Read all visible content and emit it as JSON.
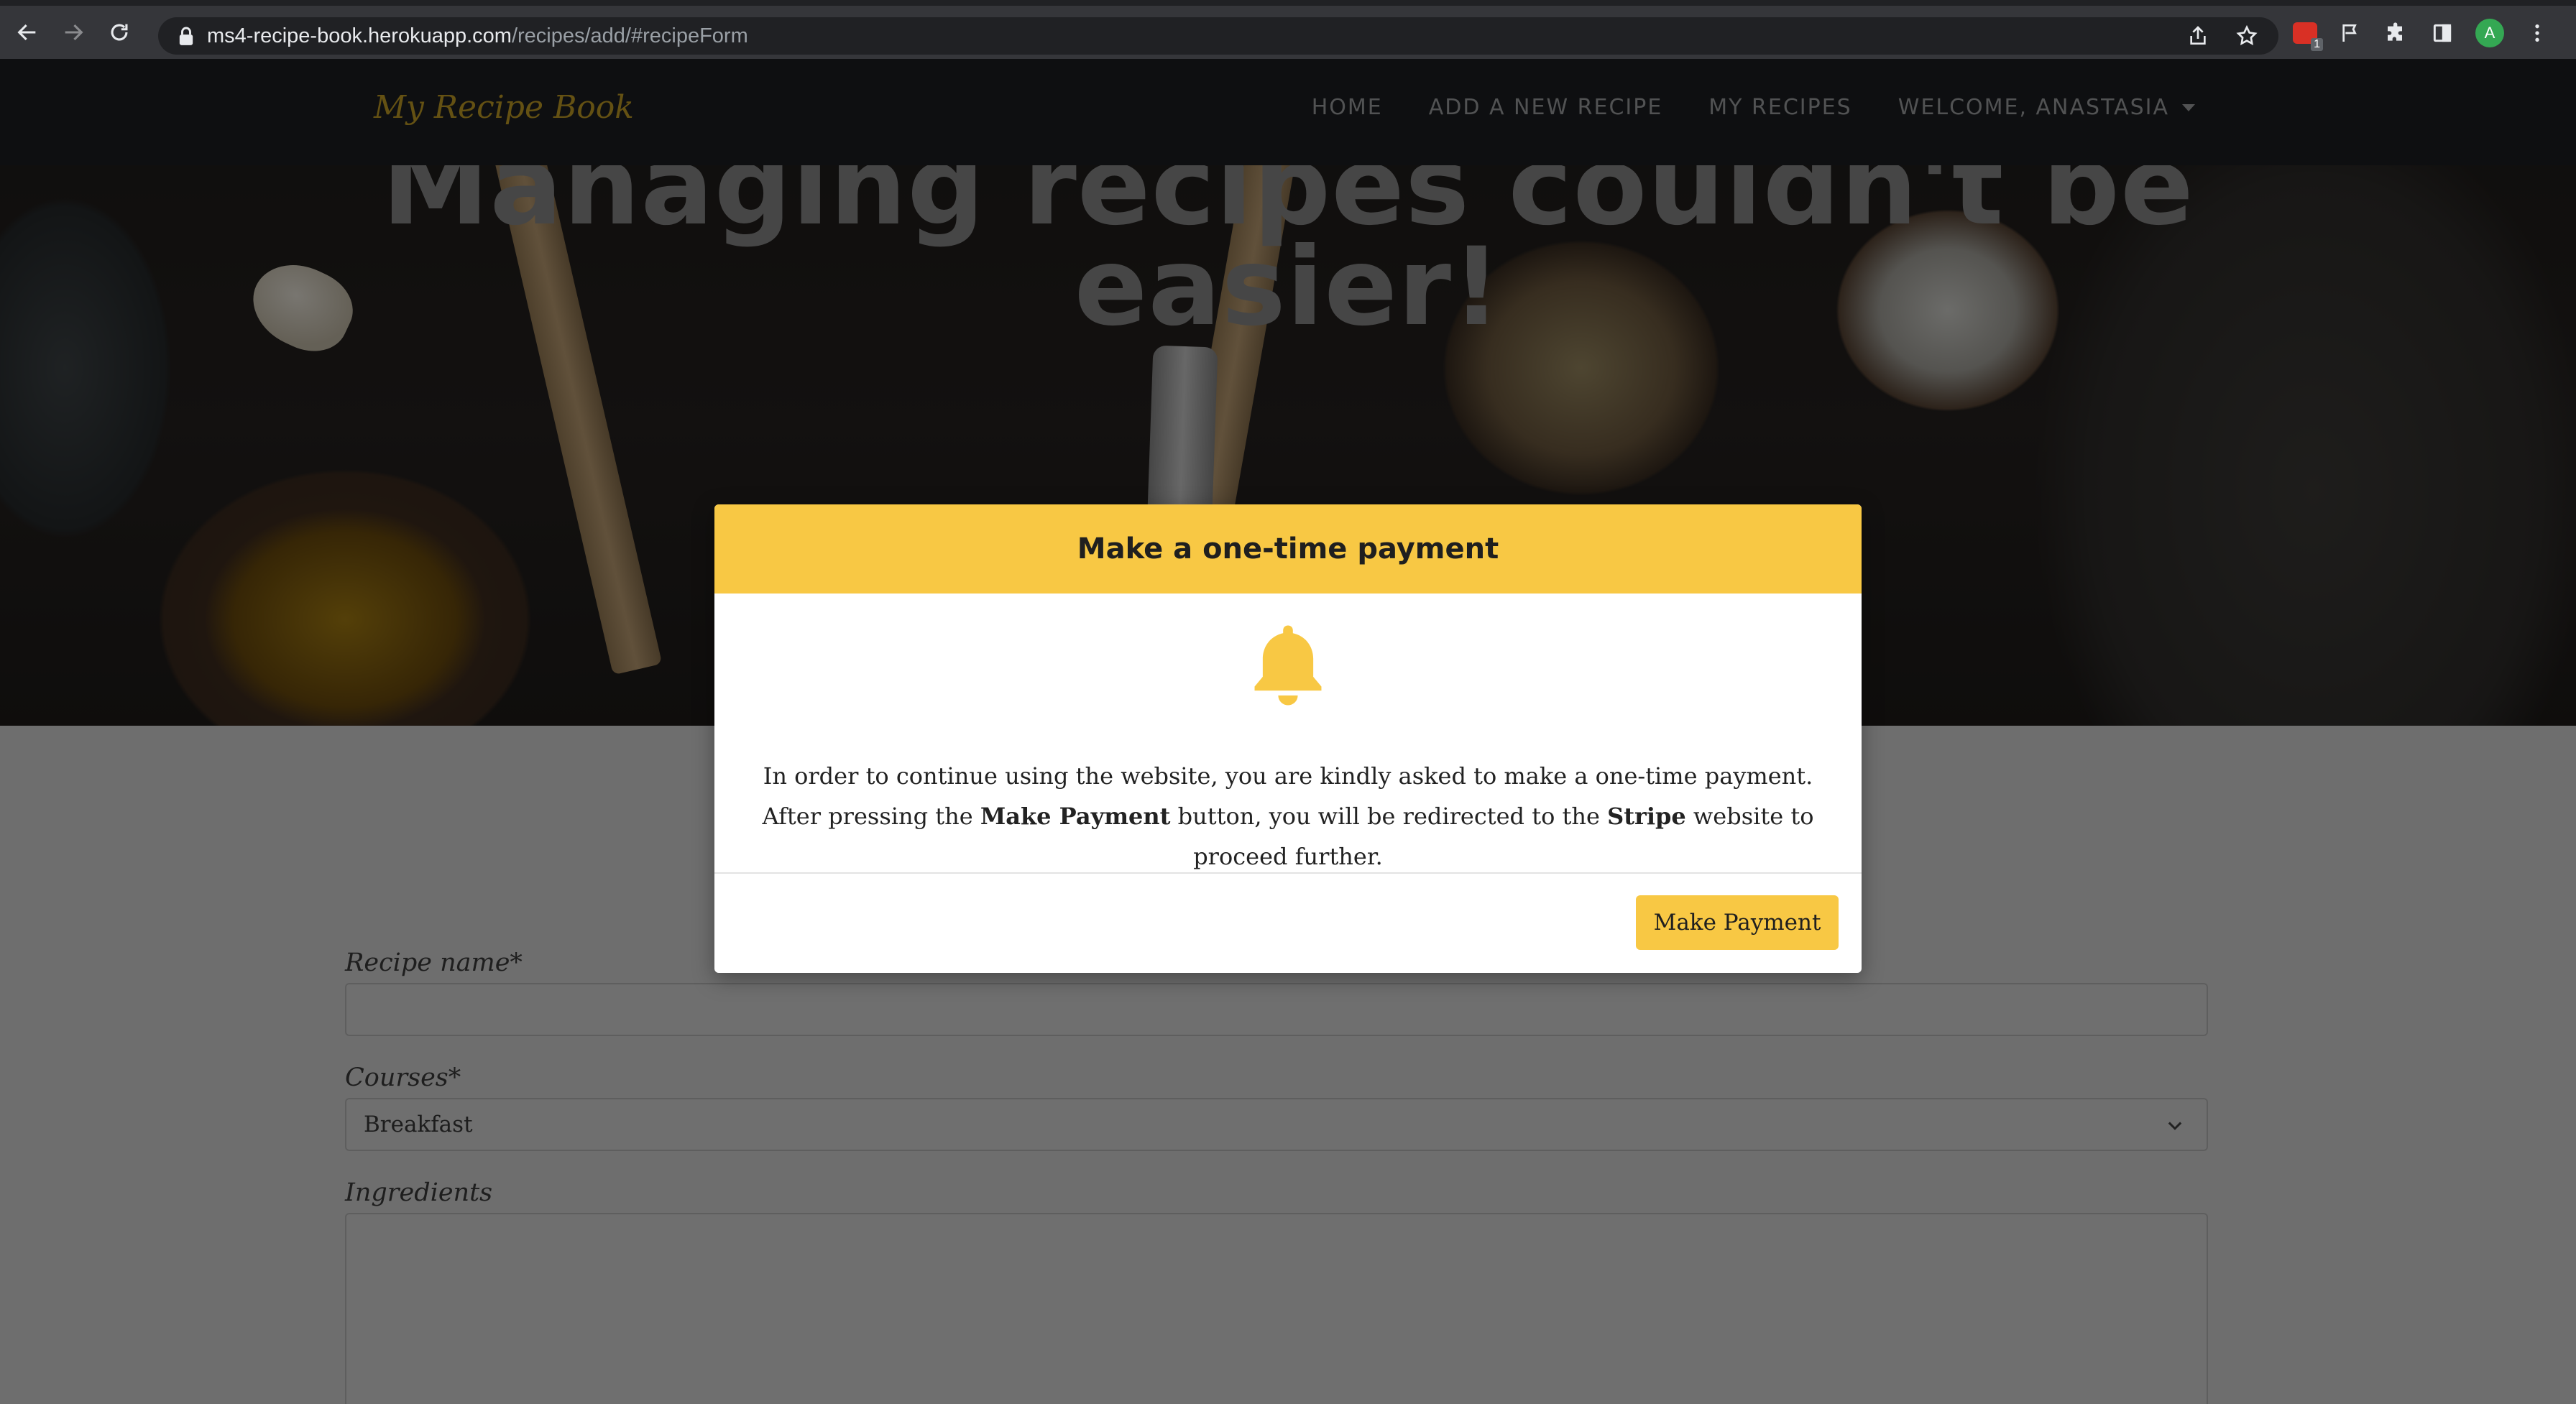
{
  "browser": {
    "url_host": "ms4-recipe-book.herokuapp.com",
    "url_path": "/recipes/add/#recipeForm",
    "profile_initial": "A"
  },
  "navbar": {
    "brand": "My Recipe Book",
    "items": [
      {
        "label": "HOME"
      },
      {
        "label": "ADD A NEW RECIPE"
      },
      {
        "label": "MY RECIPES"
      },
      {
        "label": "WELCOME, ANASTASIA"
      }
    ]
  },
  "hero": {
    "title_line1": "Managing recipes couldn't be",
    "title_line2": "easier!"
  },
  "form": {
    "recipe_name_label": "Recipe name*",
    "recipe_name_value": "",
    "courses_label": "Courses*",
    "courses_selected": "Breakfast",
    "ingredients_label": "Ingredients",
    "ingredients_value": ""
  },
  "modal": {
    "title": "Make a one-time payment",
    "icon": "bell-icon",
    "text_part1": "In order to continue using the website, you are kindly asked to make a one-time payment. After pressing the ",
    "text_bold1": "Make Payment",
    "text_part2": " button, you will be redirected to the ",
    "text_bold2": "Stripe",
    "text_part3": " website to proceed further.",
    "button_label": "Make Payment"
  },
  "colors": {
    "accent_yellow": "#f8c844",
    "brand_gold": "#c9a227",
    "navbar_bg": "#1c1f22"
  }
}
